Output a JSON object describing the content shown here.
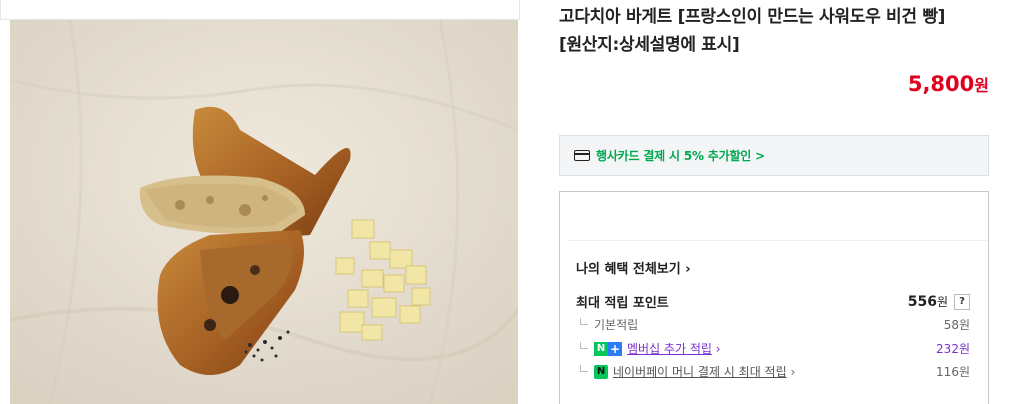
{
  "product": {
    "title_line1": "고다치아 바게트 [프랑스인이 만드는 사워도우 비건 빵]",
    "title_line2": "[원산지:상세설명에 표시]",
    "price": "5,800",
    "price_unit": "원"
  },
  "promo": {
    "text": "행사카드 결제 시 5% 추가할인 >"
  },
  "benefits": {
    "view_all": "나의 혜택 전체보기",
    "max_label": "최대 적립 포인트",
    "max_value": "556",
    "max_unit": "원",
    "help": "?",
    "rows": [
      {
        "label": "기본적립",
        "value": "58원"
      },
      {
        "label": "멤버십 추가 적립",
        "value": "232원"
      },
      {
        "label": "네이버페이 머니 결제 시 최대 적립",
        "value": "116원"
      }
    ]
  },
  "colors": {
    "price": "#e0001e",
    "promo": "#00a94f",
    "membership": "#7a2fd1",
    "naver_green": "#03c75a"
  },
  "icons": [
    "card-icon",
    "chevron-right-icon",
    "question-icon",
    "naver-n-icon",
    "plus-icon",
    "naver-pay-icon"
  ]
}
